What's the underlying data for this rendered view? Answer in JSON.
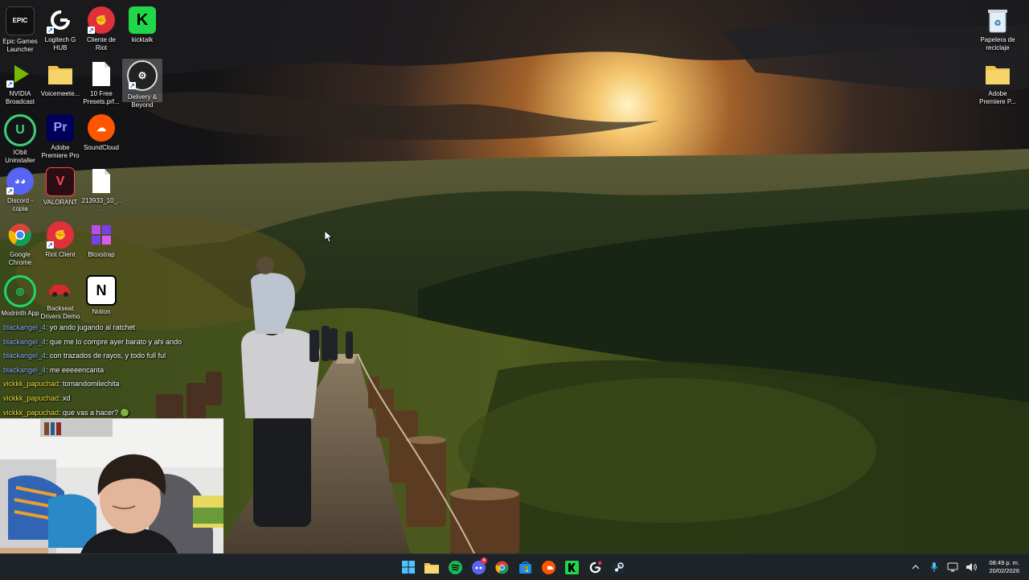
{
  "desktop": {
    "icons": [
      {
        "label": "Epic Games Launcher",
        "icon": "epic-games-icon"
      },
      {
        "label": "Logitech G HUB",
        "icon": "logitech-g-icon"
      },
      {
        "label": "Cliente de Riot",
        "icon": "riot-client-icon"
      },
      {
        "label": "kicktalk",
        "icon": "kick-icon"
      },
      {
        "label": "NVIDIA Broadcast",
        "icon": "nvidia-broadcast-icon"
      },
      {
        "label": "Voicemeete...",
        "icon": "folder-icon"
      },
      {
        "label": "10 Free Presets.prf...",
        "icon": "document-icon"
      },
      {
        "label": "Delivery & Beyond",
        "icon": "delivery-beyond-icon"
      },
      {
        "label": "IObit Uninstaller",
        "icon": "iobit-uninstaller-icon"
      },
      {
        "label": "Adobe Premiere Pro",
        "icon": "premiere-pro-icon"
      },
      {
        "label": "SoundCloud",
        "icon": "soundcloud-icon"
      },
      {
        "label": "Discord - copia",
        "icon": "discord-icon"
      },
      {
        "label": "VALORANT",
        "icon": "valorant-icon"
      },
      {
        "label": "213933_10_...",
        "icon": "document-icon"
      },
      {
        "label": "Google Chrome",
        "icon": "chrome-icon"
      },
      {
        "label": "Riot Client",
        "icon": "riot-client-icon"
      },
      {
        "label": "Bloxstrap",
        "icon": "bloxstrap-icon"
      },
      {
        "label": "Modrinth App",
        "icon": "modrinth-icon"
      },
      {
        "label": "Backseat Drivers Demo",
        "icon": "backseat-drivers-icon"
      },
      {
        "label": "Notion",
        "icon": "notion-icon"
      }
    ],
    "right_icons": [
      {
        "label": "Papelera de reciclaje",
        "icon": "recycle-bin-icon"
      },
      {
        "label": "Adobe Premiere P...",
        "icon": "folder-icon"
      }
    ]
  },
  "chat": {
    "messages": [
      {
        "user": "blackangel_4",
        "text": ": yo ando jugando al ratchet"
      },
      {
        "user": "blackangel_4",
        "text": ": que me lo compre ayer barato y ahi ando"
      },
      {
        "user": "blackangel_4",
        "text": ": con trazados de rayos, y todo full ful"
      },
      {
        "user": "blackangel_4",
        "text": ": me eeeeencanta"
      },
      {
        "user": "vickkk_papuchad",
        "text": ": tomandomilechita"
      },
      {
        "user": "vickkk_papuchad",
        "text": ": xd"
      },
      {
        "user": "vickkk_papuchad",
        "text": ": que vas a hacer? 🟢"
      }
    ]
  },
  "taskbar": {
    "apps": [
      {
        "name": "start-button",
        "icon": "windows-icon"
      },
      {
        "name": "file-explorer",
        "icon": "folder-icon"
      },
      {
        "name": "spotify",
        "icon": "spotify-icon"
      },
      {
        "name": "discord",
        "icon": "discord-icon",
        "badge": "4"
      },
      {
        "name": "chrome",
        "icon": "chrome-icon"
      },
      {
        "name": "microsoft-store",
        "icon": "store-icon"
      },
      {
        "name": "soundcloud",
        "icon": "soundcloud-icon"
      },
      {
        "name": "kick",
        "icon": "kick-icon"
      },
      {
        "name": "logitech-g-hub",
        "icon": "logitech-g-icon"
      },
      {
        "name": "steam",
        "icon": "steam-icon"
      }
    ],
    "time": "08:49 p. m.",
    "date": "20/02/2026"
  }
}
